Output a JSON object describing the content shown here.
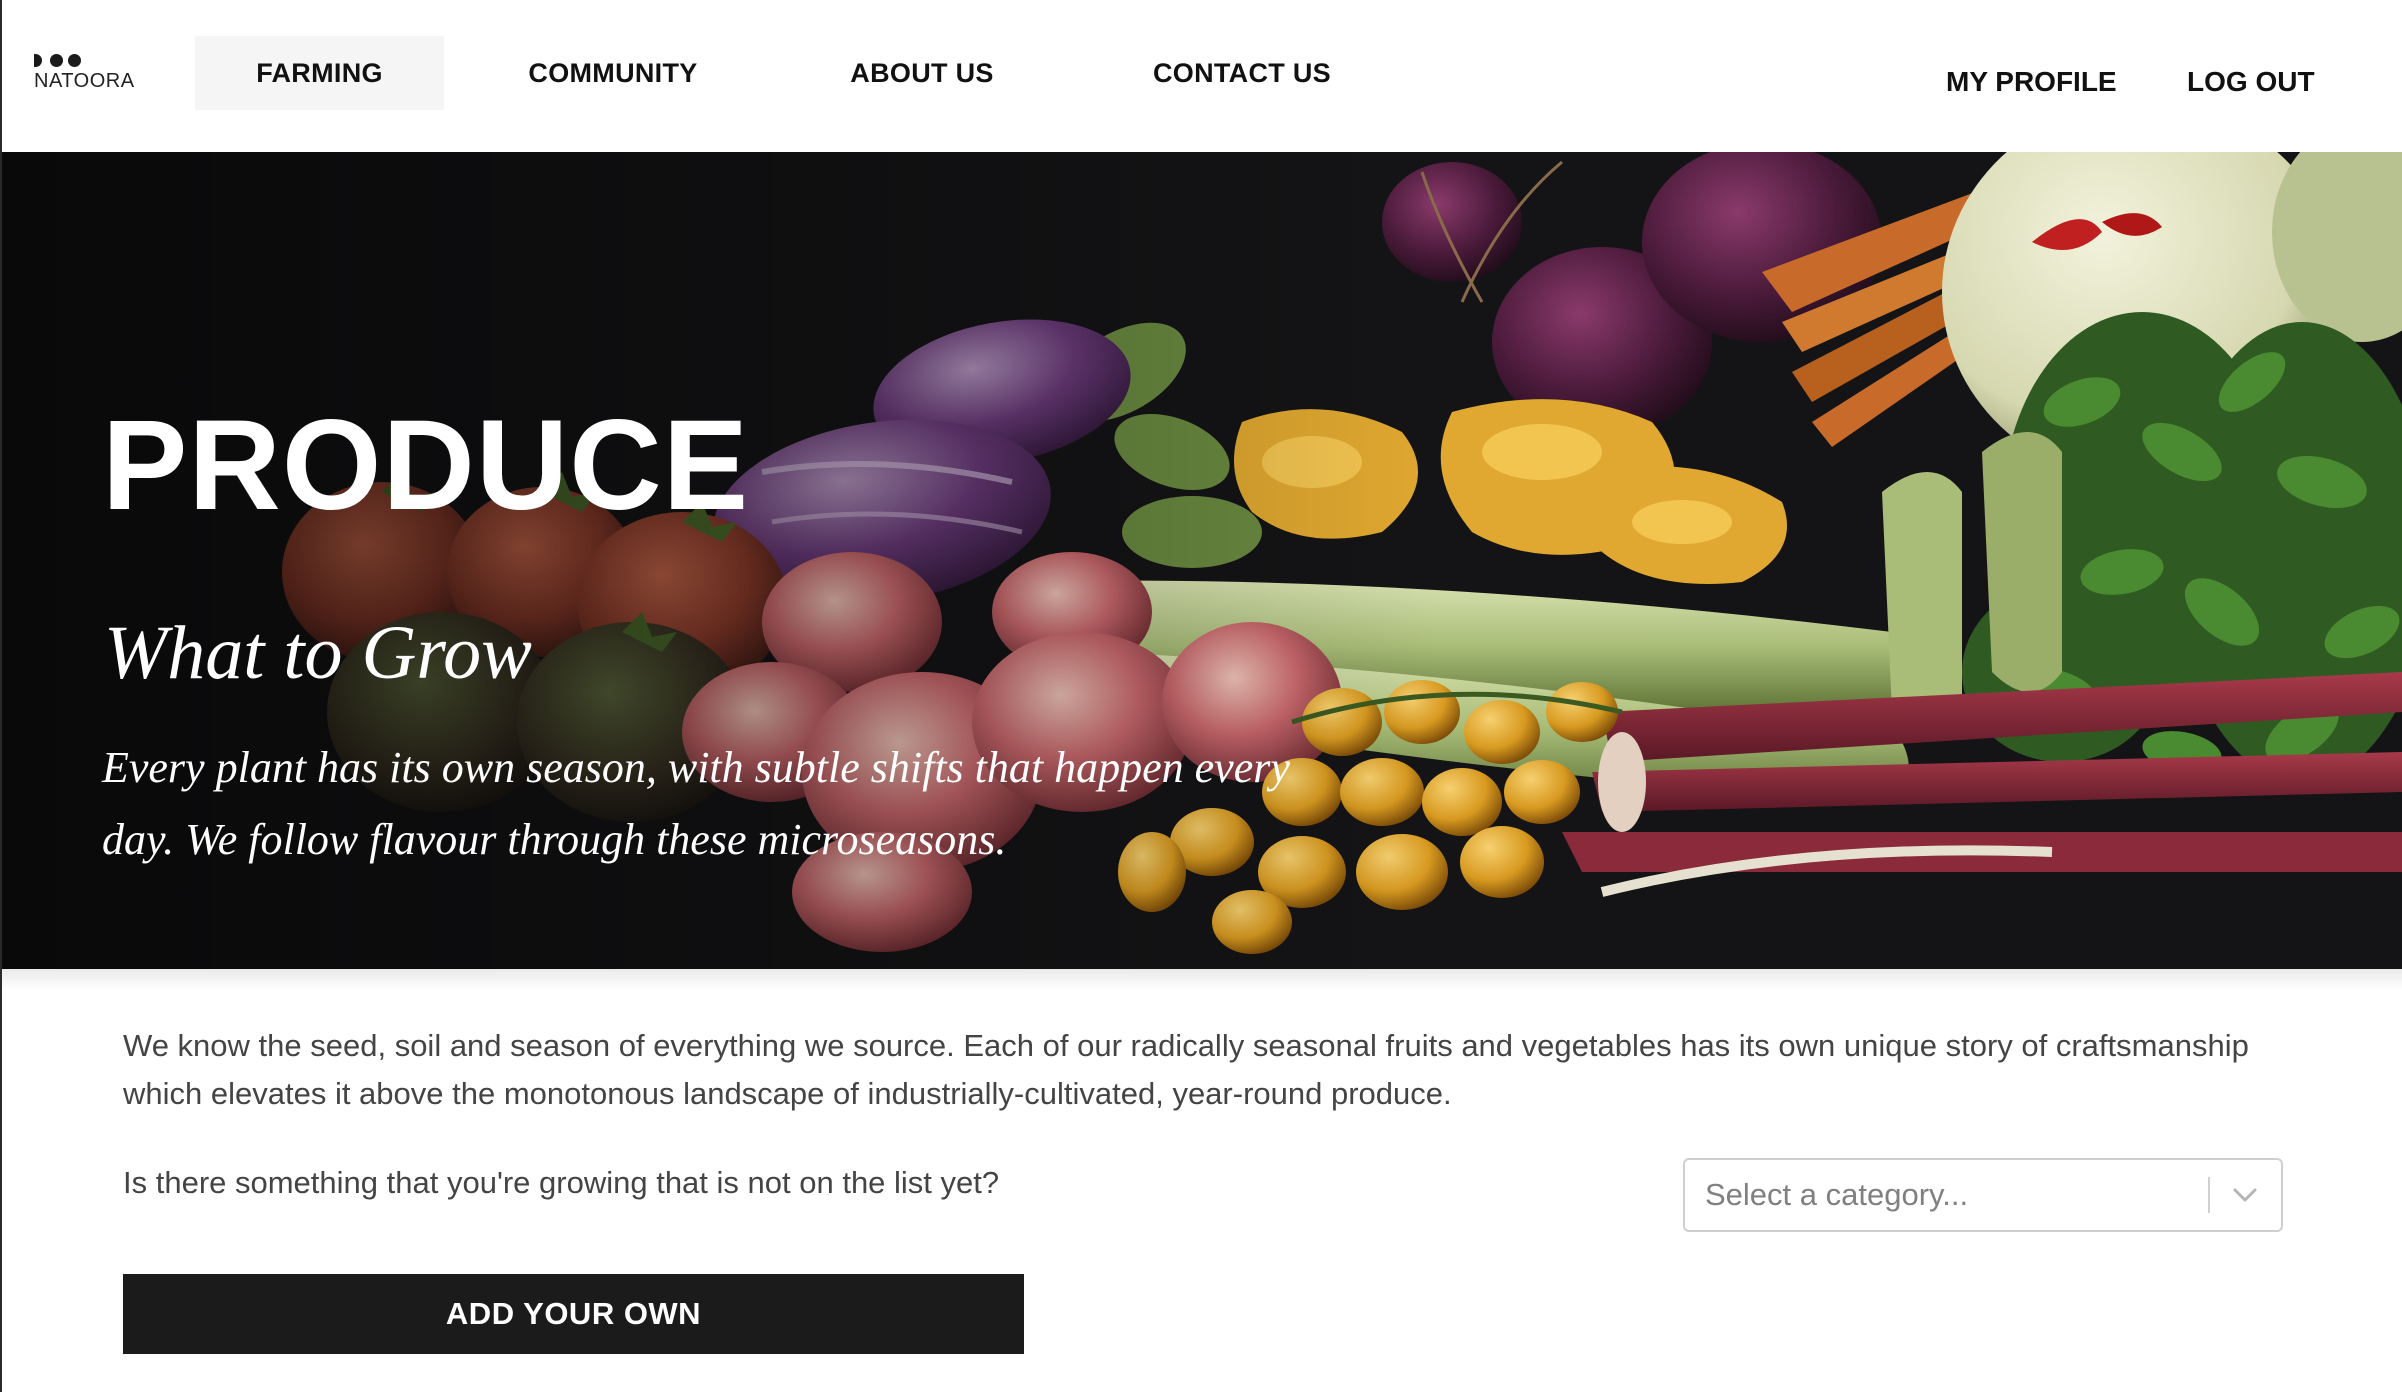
{
  "brand": {
    "logo_text": "NATOORA"
  },
  "nav": {
    "items": [
      {
        "label": "FARMING",
        "active": true
      },
      {
        "label": "COMMUNITY",
        "active": false
      },
      {
        "label": "ABOUT US",
        "active": false
      },
      {
        "label": "CONTACT US",
        "active": false
      }
    ],
    "my_profile": "MY PROFILE",
    "log_out": "LOG OUT"
  },
  "hero": {
    "title": "PRODUCE",
    "subtitle": "What to Grow",
    "description": "Every plant has its own season, with subtle shifts that happen every day. We follow flavour through these microseasons."
  },
  "main": {
    "intro": "We know the seed, soil and season of everything we source. Each of our radically seasonal fruits and vegetables has its own unique story of craftsmanship which elevates it above the monotonous landscape of industrially-cultivated, year-round produce.",
    "question": "Is there something that you're growing that is not on the list yet?",
    "add_button": "ADD YOUR OWN",
    "category_select": {
      "placeholder": "Select a category..."
    }
  },
  "icons": {
    "logo": "natoora-dots-icon",
    "select_toggle": "chevron-down-icon"
  },
  "colors": {
    "hero_bg": "#121214",
    "button_bg": "#1b1b1b",
    "nav_active_bg": "#f5f5f5",
    "body_text": "#444444"
  }
}
